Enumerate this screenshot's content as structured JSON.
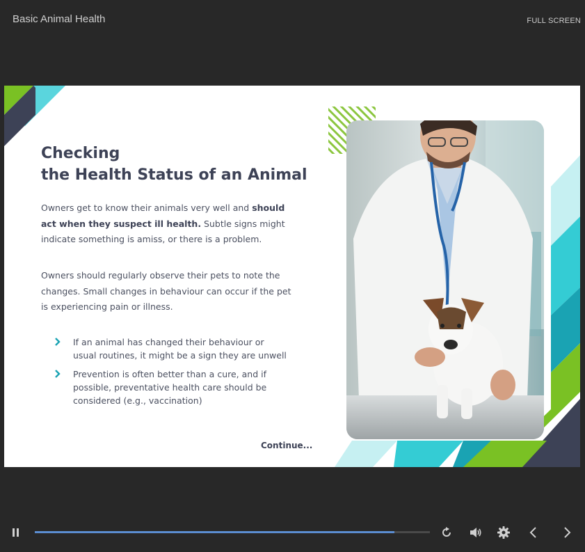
{
  "header": {
    "course_title": "Basic Animal Health",
    "fullscreen_label": "FULL SCREEN"
  },
  "slide": {
    "heading_line1": "Checking",
    "heading_line2": "the Health Status of an Animal",
    "paragraph1": {
      "text_before": "Owners get to know their animals very well and ",
      "bold": "should act when they suspect ill health.",
      "text_after": " Subtle signs might indicate something is amiss, or there is a problem."
    },
    "paragraph2": "Owners should regularly observe their pets to note the changes. Small changes in behaviour can occur if the pet is experiencing pain or illness.",
    "bullets": [
      "If an animal has changed their behaviour or usual routines, it might be a sign they are unwell",
      "Prevention is often better than a cure, and if possible, preventative health care should be considered (e.g., vaccination)"
    ],
    "continue_label": "Continue...",
    "image_icon": "veterinarian-with-dog-photo"
  },
  "player": {
    "progress": 0.91,
    "icons": {
      "pause": "pause-icon",
      "replay": "replay-icon",
      "volume": "volume-icon",
      "settings": "gear-icon",
      "prev": "chevron-left-icon",
      "next": "chevron-right-icon"
    }
  },
  "colors": {
    "background": "#282828",
    "heading": "#3d4256",
    "accent_teal": "#1aa3b3",
    "accent_green": "#7ac124",
    "light_cyan": "#b6ecee",
    "navy": "#3d4256",
    "progress": "#5b8dd1"
  }
}
